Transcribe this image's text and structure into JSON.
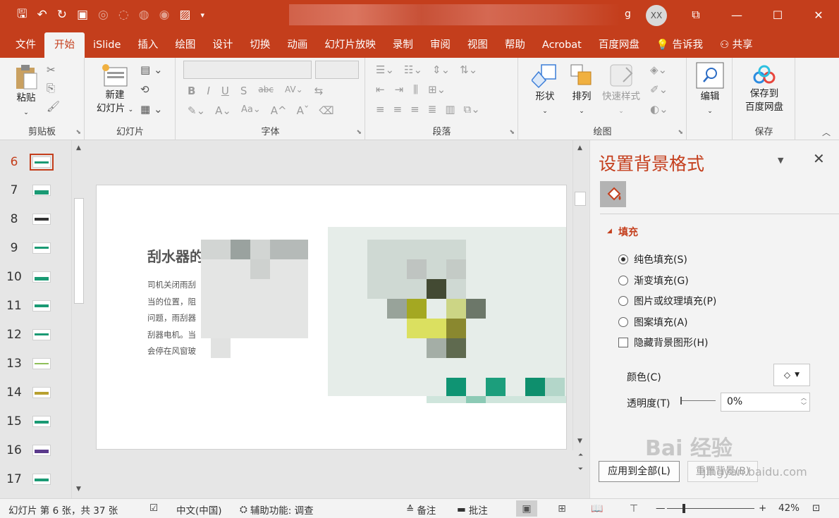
{
  "window": {
    "title_suffix": "g",
    "user_initials": "XX"
  },
  "tabs": [
    "文件",
    "开始",
    "iSlide",
    "插入",
    "绘图",
    "设计",
    "切换",
    "动画",
    "幻灯片放映",
    "录制",
    "审阅",
    "视图",
    "帮助",
    "Acrobat",
    "百度网盘"
  ],
  "tell_me": "告诉我",
  "share": "共享",
  "ribbon": {
    "clipboard": {
      "paste": "粘贴",
      "label": "剪贴板"
    },
    "slides": {
      "new_slide_line1": "新建",
      "new_slide_line2": "幻灯片",
      "label": "幻灯片"
    },
    "font": {
      "label": "字体"
    },
    "paragraph": {
      "label": "段落"
    },
    "drawing": {
      "shapes": "形状",
      "arrange": "排列",
      "quick_styles": "快速样式",
      "label": "绘图"
    },
    "editing": {
      "edit": "编辑"
    },
    "save": {
      "line1": "保存到",
      "line2": "百度网盘",
      "label": "保存"
    }
  },
  "thumbnails": [
    "6",
    "7",
    "8",
    "9",
    "10",
    "11",
    "12",
    "13",
    "14",
    "15",
    "16",
    "17"
  ],
  "active_slide": "6",
  "slide": {
    "title": "刮水器的",
    "body": [
      "司机关闭雨刮",
      "当的位置，阻",
      "问题，雨刮器",
      "刮器电机。当",
      "会停在风窗玻"
    ]
  },
  "pane": {
    "title": "设置背景格式",
    "section": "填充",
    "options": [
      {
        "label": "纯色填充(S)",
        "selected": true
      },
      {
        "label": "渐变填充(G)",
        "selected": false
      },
      {
        "label": "图片或纹理填充(P)",
        "selected": false
      },
      {
        "label": "图案填充(A)",
        "selected": false
      }
    ],
    "hide_bg": "隐藏背景图形(H)",
    "color_label": "颜色(C)",
    "transparency_label": "透明度(T)",
    "transparency_value": "0%",
    "apply_all": "应用到全部(L)",
    "reset": "重置背景(B)"
  },
  "watermark": {
    "main": "Bai 经验",
    "sub": "jingyan.baidu.com"
  },
  "status": {
    "slide_info": "幻灯片 第 6 张，共 37 张",
    "language": "中文(中国)",
    "accessibility": "辅助功能: 调查",
    "notes": "备注",
    "comments": "批注",
    "zoom": "42%"
  },
  "colors": {
    "accent": "#c43e1c",
    "slide_green": "#1a9a74"
  }
}
